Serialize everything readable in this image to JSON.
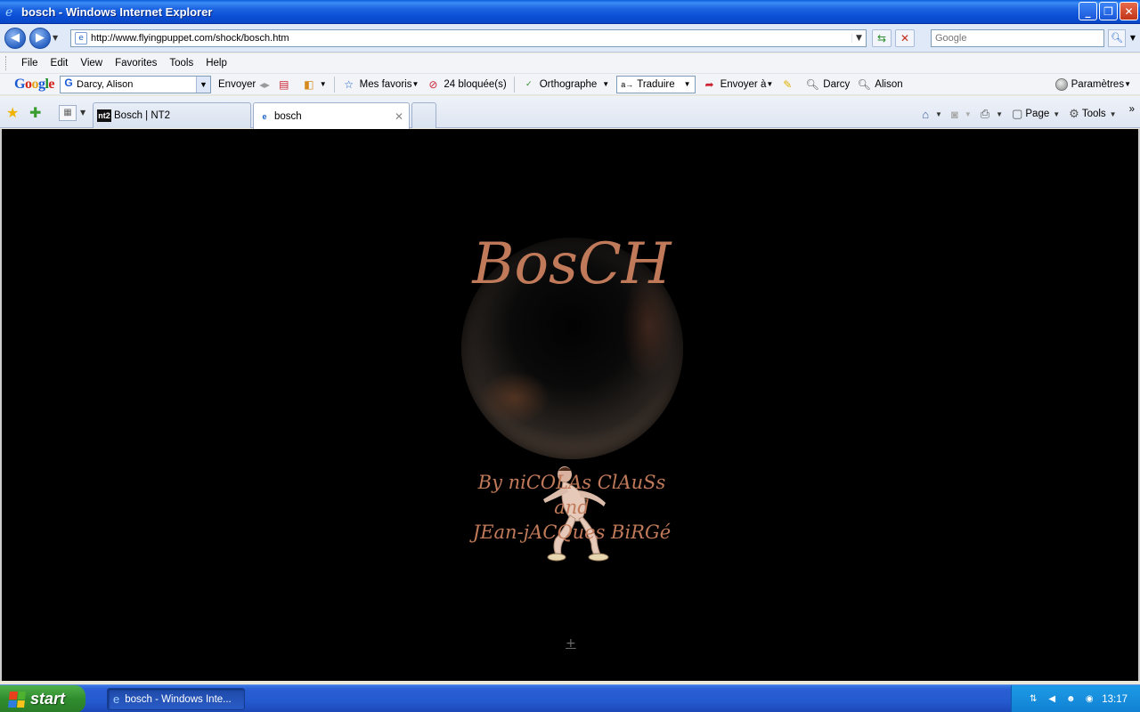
{
  "window": {
    "title": "bosch - Windows Internet Explorer",
    "buttons": {
      "minimize": "_",
      "maximize": "❐",
      "close": "✕"
    }
  },
  "address_bar": {
    "url": "http://www.flyingpuppet.com/shock/bosch.htm",
    "search_placeholder": "Google"
  },
  "menu": [
    "File",
    "Edit",
    "View",
    "Favorites",
    "Tools",
    "Help"
  ],
  "google_toolbar": {
    "search_value": "Darcy, Alison",
    "send_label": "Envoyer",
    "bookmarks_label": "Mes favoris",
    "blocked_label": "24 bloquée(s)",
    "spell_label": "Orthographe",
    "translate_label": "Traduire",
    "sendto_label": "Envoyer à",
    "highlight_1": "Darcy",
    "highlight_2": "Alison",
    "settings_label": "Paramètres"
  },
  "tabs": [
    {
      "label": "Bosch | NT2",
      "favicon": "nt2"
    },
    {
      "label": "bosch",
      "favicon": "e",
      "active": true
    }
  ],
  "command_bar": {
    "page_label": "Page",
    "tools_label": "Tools",
    "more": "»"
  },
  "content": {
    "title": "BosCH",
    "credits_line1": "By niCOLAs ClAuSs",
    "credits_line2": "and",
    "credits_line3": "JEan-jACQues BiRGé",
    "bottom_link": "+"
  },
  "taskbar": {
    "start_label": "start",
    "task_item": "bosch - Windows Inte...",
    "clock": "13:17"
  },
  "colors": {
    "accent_title": "#c07a5a",
    "content_bg": "#000000"
  }
}
